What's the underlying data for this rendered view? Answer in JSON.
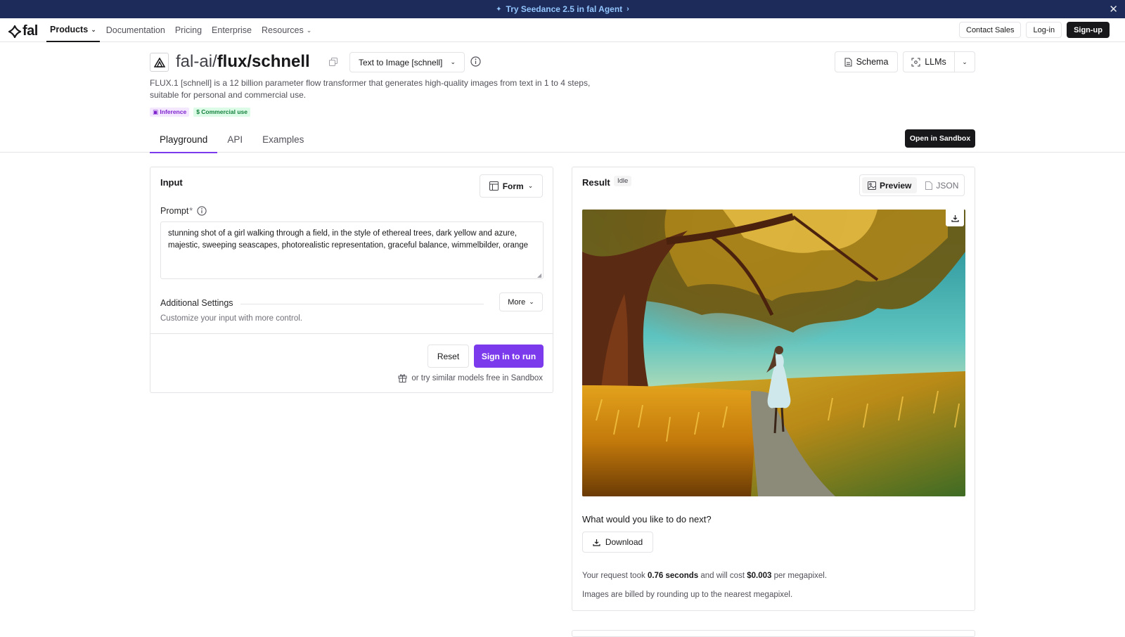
{
  "banner": {
    "text": "Try Seedance 2.5 in fal Agent",
    "close_icon": "close-icon"
  },
  "nav": {
    "logo_text": "fal",
    "items": [
      {
        "label": "Products",
        "has_dropdown": true,
        "active": true
      },
      {
        "label": "Documentation",
        "has_dropdown": false,
        "active": false
      },
      {
        "label": "Pricing",
        "has_dropdown": false,
        "active": false
      },
      {
        "label": "Enterprise",
        "has_dropdown": false,
        "active": false
      },
      {
        "label": "Resources",
        "has_dropdown": true,
        "active": false
      }
    ],
    "contact_sales": "Contact Sales",
    "login": "Log-in",
    "signup": "Sign-up"
  },
  "model": {
    "owner": "fal-ai/",
    "name": "flux/schnell",
    "variant": "Text to Image [schnell]",
    "description": "FLUX.1 [schnell] is a 12 billion parameter flow transformer that generates high-quality images from text in 1 to 4 steps, suitable for personal and commercial use.",
    "tags": {
      "inference": "Inference",
      "commercial": "Commercial use"
    },
    "schema_label": "Schema",
    "llms_label": "LLMs"
  },
  "tabs": {
    "playground": "Playground",
    "api": "API",
    "examples": "Examples"
  },
  "open_sandbox": "Open in Sandbox",
  "input": {
    "title": "Input",
    "form_label": "Form",
    "prompt_label": "Prompt",
    "prompt_required": "*",
    "prompt_value": "stunning shot of a girl walking through a field, in the style of ethereal trees, dark yellow and azure, majestic, sweeping seascapes, photorealistic representation, graceful balance, wimmelbilder, orange",
    "additional_settings": "Additional Settings",
    "additional_sub": "Customize your input with more control.",
    "more_label": "More",
    "reset_label": "Reset",
    "run_label": "Sign in to run",
    "sandbox_hint": "or try similar models free in Sandbox"
  },
  "result": {
    "title": "Result",
    "status": "Idle",
    "preview_label": "Preview",
    "json_label": "JSON",
    "next_question": "What would you like to do next?",
    "download_label": "Download",
    "stats_prefix": "Your request took",
    "duration": "0.76 seconds",
    "stats_mid": "and will cost",
    "cost": "$0.003",
    "stats_suffix": "per megapixel.",
    "billing_note": "Images are billed by rounding up to the nearest megapixel."
  },
  "colors": {
    "accent": "#7c3aed",
    "banner_bg": "#1c2b5a",
    "dark": "#18181b"
  }
}
